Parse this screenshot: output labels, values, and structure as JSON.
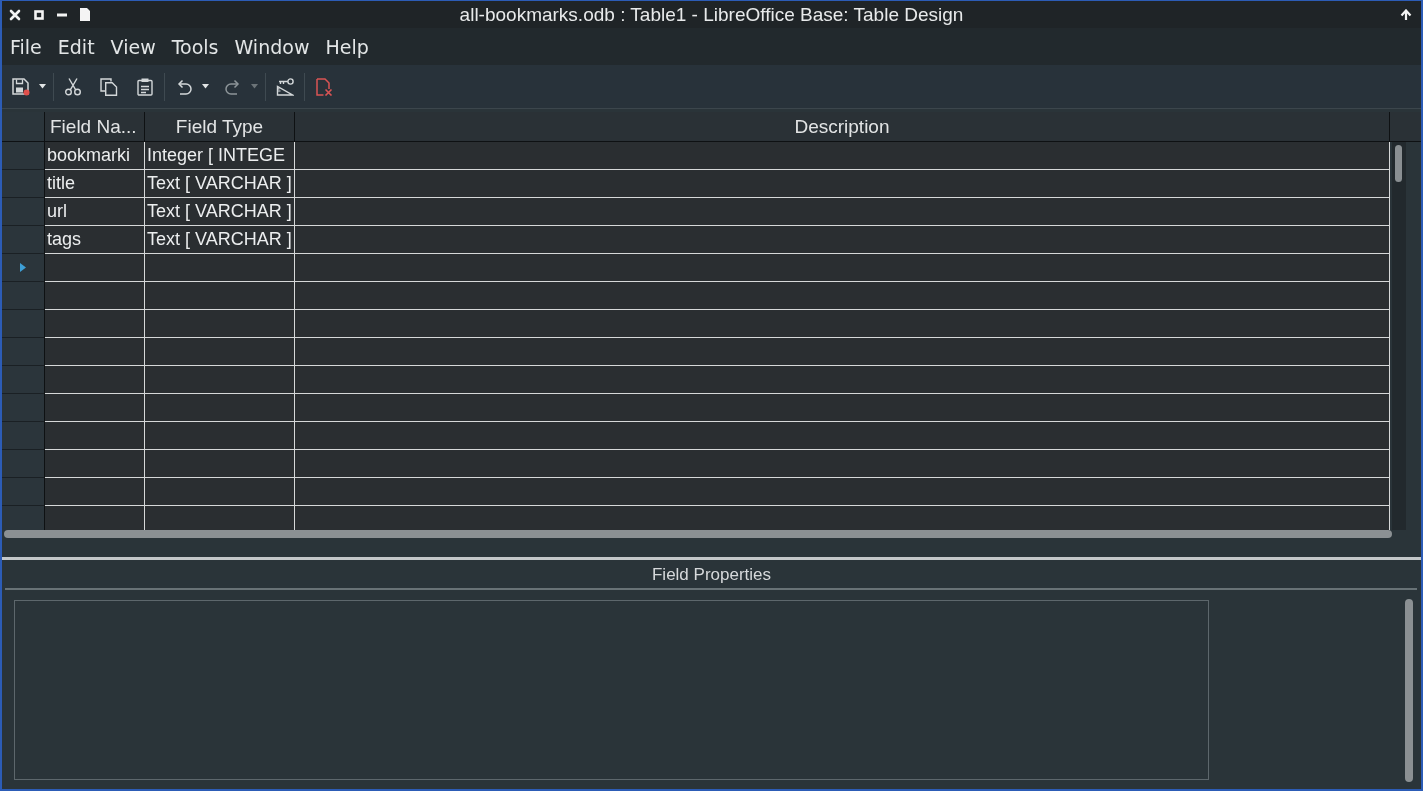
{
  "window": {
    "title": "all-bookmarks.odb : Table1 - LibreOffice Base: Table Design"
  },
  "menu_bar": [
    "File",
    "Edit",
    "View",
    "Tools",
    "Window",
    "Help"
  ],
  "toolbar": [
    {
      "kind": "save",
      "dropdown": true,
      "disabled": false
    },
    {
      "kind": "separator"
    },
    {
      "kind": "cut",
      "disabled": false
    },
    {
      "kind": "copy",
      "disabled": false
    },
    {
      "kind": "paste",
      "disabled": false
    },
    {
      "kind": "separator"
    },
    {
      "kind": "undo",
      "dropdown": true,
      "disabled": false
    },
    {
      "kind": "redo",
      "dropdown": true,
      "disabled": true
    },
    {
      "kind": "separator"
    },
    {
      "kind": "index_design",
      "disabled": false
    },
    {
      "kind": "separator"
    },
    {
      "kind": "close",
      "disabled": false
    }
  ],
  "table": {
    "columns": [
      "Field Na...",
      "Field Type",
      "Description"
    ],
    "rows": [
      {
        "field_name": "bookmarki",
        "field_type": "Integer [ INTEGE",
        "selected": false
      },
      {
        "field_name": "title",
        "field_type": "Text [ VARCHAR ]",
        "selected": false
      },
      {
        "field_name": "url",
        "field_type": "Text [ VARCHAR ]",
        "selected": false
      },
      {
        "field_name": "tags",
        "field_type": "Text [ VARCHAR ]",
        "selected": false
      },
      {
        "selected": true
      }
    ]
  },
  "field_properties": {
    "title": "Field Properties"
  }
}
